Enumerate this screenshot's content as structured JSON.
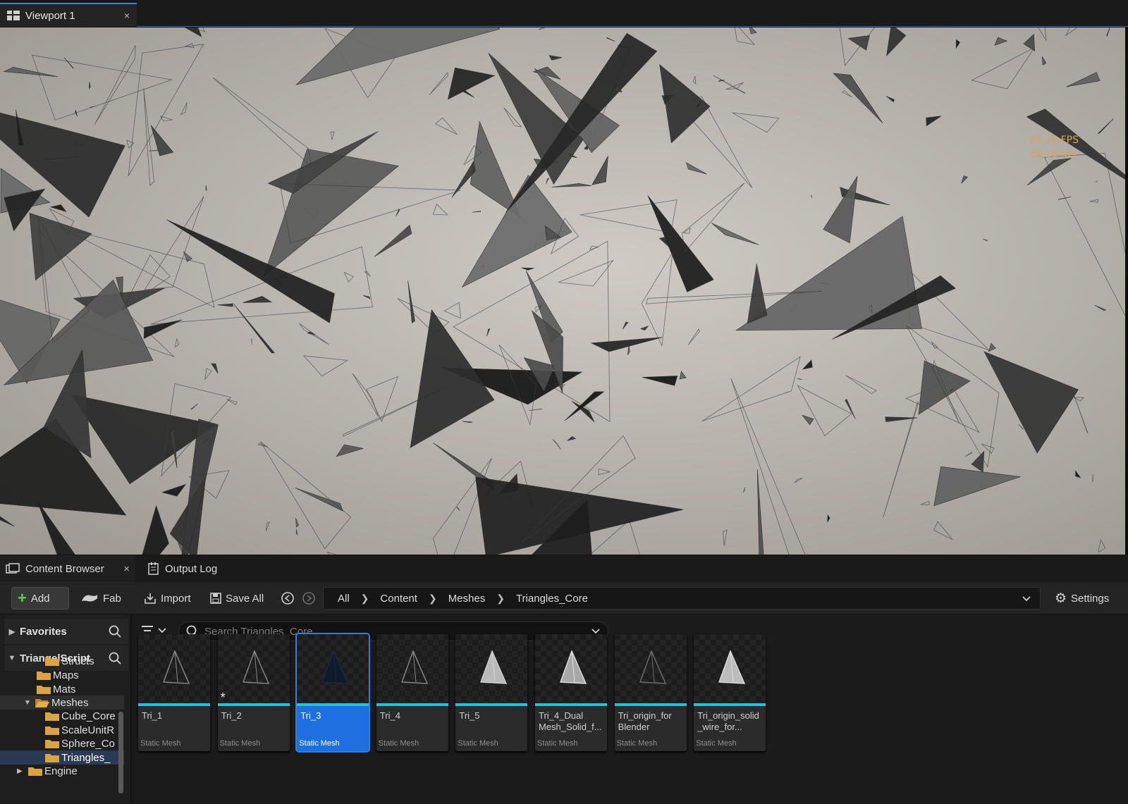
{
  "viewport_tab": {
    "title": "Viewport 1",
    "close": "×"
  },
  "stats": {
    "fps": "26.19 FPS",
    "ms": "38.18 ms"
  },
  "bottom_tabs": [
    {
      "label": "Content Browser",
      "close": "×"
    },
    {
      "label": "Output Log"
    }
  ],
  "toolbar": {
    "add": "Add",
    "fab": "Fab",
    "import": "Import",
    "save_all": "Save All",
    "settings": "Settings"
  },
  "breadcrumb": [
    "All",
    "Content",
    "Meshes",
    "Triangles_Core"
  ],
  "sidebar": {
    "favorites": "Favorites",
    "project": "TriangelScript",
    "tree": [
      {
        "label": "Structs"
      },
      {
        "label": "Maps"
      },
      {
        "label": "Mats"
      },
      {
        "label": "Meshes"
      },
      {
        "label": "Cube_Core"
      },
      {
        "label": "ScaleUnitR"
      },
      {
        "label": "Sphere_Co"
      },
      {
        "label": "Triangles_"
      },
      {
        "label": "Engine"
      }
    ]
  },
  "search": {
    "placeholder": "Search Triangles_Core"
  },
  "assets": [
    {
      "name": "Tri_1",
      "type": "Static Mesh"
    },
    {
      "name": "Tri_2",
      "type": "Static Mesh",
      "modified": "*"
    },
    {
      "name": "Tri_3",
      "type": "Static Mesh",
      "selected": true
    },
    {
      "name": "Tri_4",
      "type": "Static Mesh"
    },
    {
      "name": "Tri_5",
      "type": "Static Mesh"
    },
    {
      "name": "Tri_4_Dual Mesh_Solid_f...",
      "type": "Static Mesh"
    },
    {
      "name": "Tri_origin_for Blender",
      "type": "Static Mesh"
    },
    {
      "name": "Tri_origin_solid _wire_for...",
      "type": "Static Mesh"
    }
  ],
  "colors": {
    "accent": "#1e6fe0",
    "asset_bar": "#1fc3e0",
    "stats": "#d9a257"
  }
}
